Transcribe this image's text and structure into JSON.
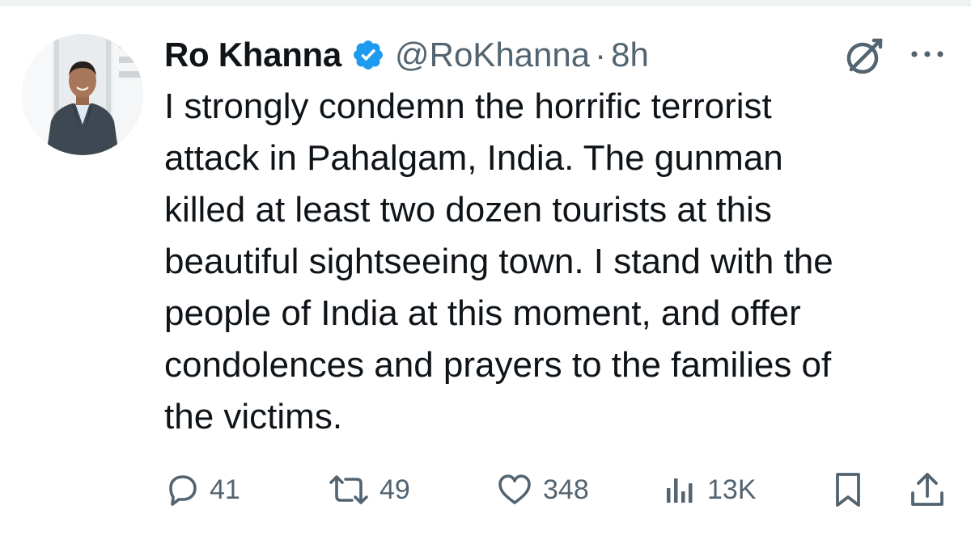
{
  "tweet": {
    "author": {
      "display_name": "Ro Khanna",
      "handle": "@RoKhanna",
      "verified": true
    },
    "separator": "·",
    "timestamp": "8h",
    "text": "I strongly condemn the horrific terrorist\nattack in Pahalgam, India. The gunman\nkilled at least two dozen tourists at this\nbeautiful sightseeing town. I stand with the\npeople of India at this moment, and offer\ncondolences and prayers to the families of\nthe victims.",
    "metrics": {
      "replies": "41",
      "reposts": "49",
      "likes": "348",
      "views": "13K"
    }
  },
  "icons": {
    "avatar": "profile-photo",
    "verified": "verified-badge-icon",
    "grok": "grok-icon",
    "more": "more-dots-icon",
    "reply": "reply-bubble-icon",
    "repost": "repost-arrows-icon",
    "like": "heart-icon",
    "views": "analytics-bars-icon",
    "bookmark": "bookmark-icon",
    "share": "share-upload-icon"
  },
  "colors": {
    "text_primary": "#0f1419",
    "text_secondary": "#536471",
    "verified_blue": "#1d9bf0"
  }
}
